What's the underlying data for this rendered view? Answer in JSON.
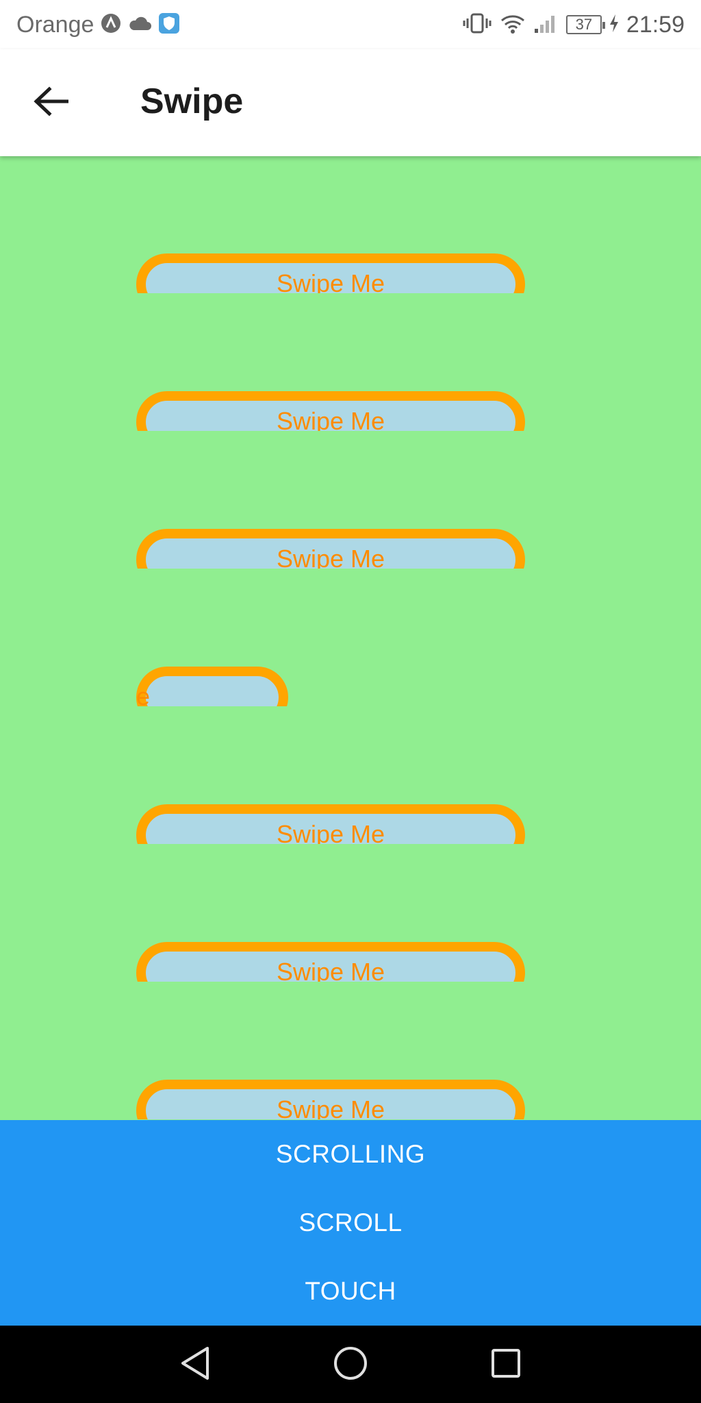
{
  "status_bar": {
    "carrier": "Orange",
    "battery": "37",
    "time": "21:59",
    "icons": [
      "app-a-icon",
      "cloud-icon",
      "shield-icon",
      "vibrate-icon",
      "wifi-icon",
      "signal-icon",
      "battery-icon",
      "charging-icon"
    ]
  },
  "app_bar": {
    "title": "Swipe",
    "back_icon": "arrow-left-icon"
  },
  "colors": {
    "content_bg": "#90ee90",
    "item_fill": "#add8e6",
    "item_border": "#ffa500",
    "item_text": "#ff8c00",
    "button_bg": "#2196f3"
  },
  "swipe_items": [
    {
      "label": "Swipe Me"
    },
    {
      "label": "Swipe Me"
    },
    {
      "label": "Swipe Me"
    },
    {
      "label": "e"
    },
    {
      "label": "Swipe Me"
    },
    {
      "label": "Swipe Me"
    },
    {
      "label": "Swipe Me"
    }
  ],
  "buttons": {
    "scrolling": "SCROLLING",
    "scroll": "SCROLL",
    "touch": "TOUCH"
  },
  "nav_bar": {
    "icons": [
      "back-triangle-icon",
      "home-circle-icon",
      "recents-square-icon"
    ]
  }
}
